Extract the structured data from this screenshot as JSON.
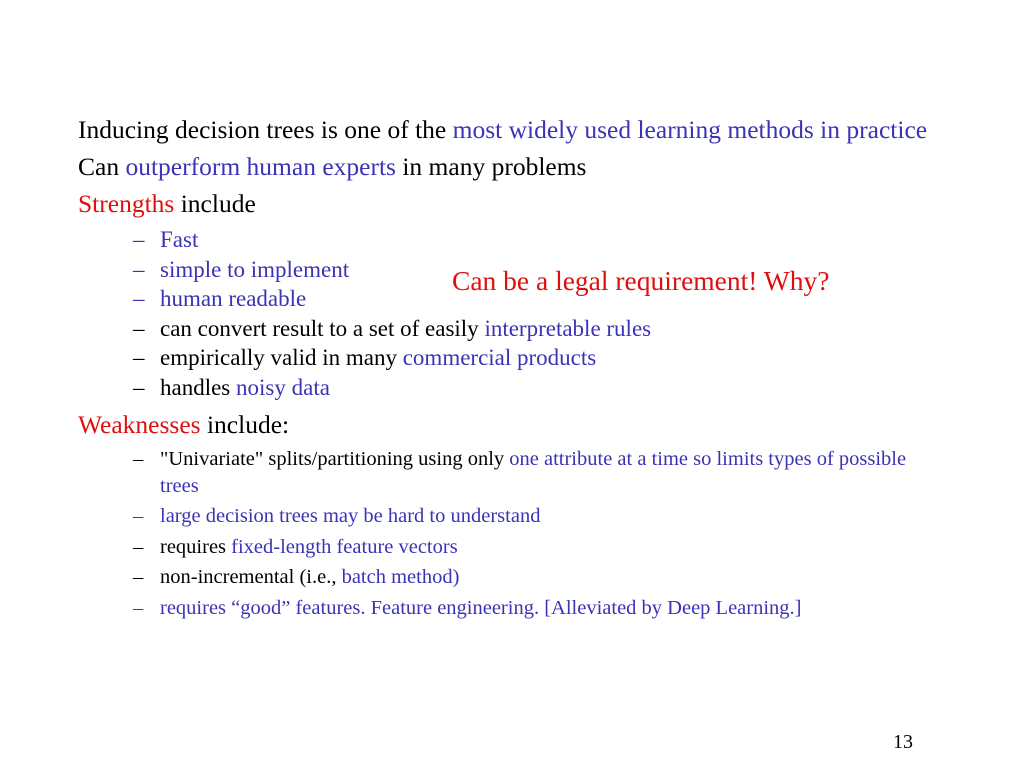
{
  "slide": {
    "page_number": "13",
    "colors": {
      "accent_blue": "#3b33b5",
      "accent_red": "#e00f0f",
      "text_black": "#000000",
      "background": "#ffffff"
    },
    "bullets": [
      {
        "level": 1,
        "runs": [
          {
            "text": "Inducing decision trees is one of the ",
            "color": "black"
          },
          {
            "text": "most widely used learning methods in practice",
            "color": "blue"
          }
        ]
      },
      {
        "level": 1,
        "runs": [
          {
            "text": "Can ",
            "color": "black"
          },
          {
            "text": "outperform human experts",
            "color": "blue"
          },
          {
            "text": " in many problems",
            "color": "black"
          }
        ]
      },
      {
        "level": 1,
        "runs": [
          {
            "text": "Strengths",
            "color": "red"
          },
          {
            "text": " include",
            "color": "black"
          }
        ]
      },
      {
        "level": 2,
        "marker": "–",
        "marker_color": "blue",
        "runs": [
          {
            "text": "Fast",
            "color": "blue"
          }
        ]
      },
      {
        "level": 2,
        "marker": "–",
        "marker_color": "blue",
        "runs": [
          {
            "text": "simple to implement",
            "color": "blue"
          }
        ]
      },
      {
        "level": 2,
        "marker": "–",
        "marker_color": "blue",
        "runs": [
          {
            "text": "human readable",
            "color": "blue"
          }
        ]
      },
      {
        "level": 2,
        "marker": "–",
        "marker_color": "black",
        "runs": [
          {
            "text": "can convert result to a set of easily ",
            "color": "black"
          },
          {
            "text": "interpretable rules",
            "color": "blue"
          }
        ]
      },
      {
        "level": 2,
        "marker": "–",
        "marker_color": "black",
        "runs": [
          {
            "text": "empirically valid in many ",
            "color": "black"
          },
          {
            "text": "commercial products",
            "color": "blue"
          }
        ]
      },
      {
        "level": 2,
        "marker": "–",
        "marker_color": "black",
        "runs": [
          {
            "text": "handles ",
            "color": "black"
          },
          {
            "text": "noisy data",
            "color": "blue"
          }
        ]
      },
      {
        "level": 1,
        "runs": [
          {
            "text": "Weaknesses",
            "color": "red"
          },
          {
            "text": " include:",
            "color": "black"
          }
        ]
      },
      {
        "level": 2,
        "small": true,
        "marker": "–",
        "marker_color": "black",
        "runs": [
          {
            "text": "\"Univariate\" splits/partitioning using only ",
            "color": "black"
          },
          {
            "text": "one attribute at a time so limits types of possible trees",
            "color": "blue"
          }
        ]
      },
      {
        "level": 2,
        "small": true,
        "marker": "–",
        "marker_color": "blue",
        "runs": [
          {
            "text": "large decision trees may be hard to understand",
            "color": "blue"
          }
        ]
      },
      {
        "level": 2,
        "small": true,
        "marker": "–",
        "marker_color": "black",
        "runs": [
          {
            "text": "requires ",
            "color": "black"
          },
          {
            "text": "fixed-length feature vectors",
            "color": "blue"
          }
        ]
      },
      {
        "level": 2,
        "small": true,
        "marker": "–",
        "marker_color": "black",
        "runs": [
          {
            "text": "non-incremental (i.e., ",
            "color": "black"
          },
          {
            "text": "batch method)",
            "color": "blue"
          }
        ]
      },
      {
        "level": 2,
        "small": true,
        "marker": "–",
        "marker_color": "blue",
        "runs": [
          {
            "text": "requires “good” features. Feature engineering. [Alleviated by Deep Learning.]",
            "color": "blue"
          }
        ]
      }
    ],
    "callout": {
      "text": "Can be a legal requirement! Why?"
    }
  }
}
